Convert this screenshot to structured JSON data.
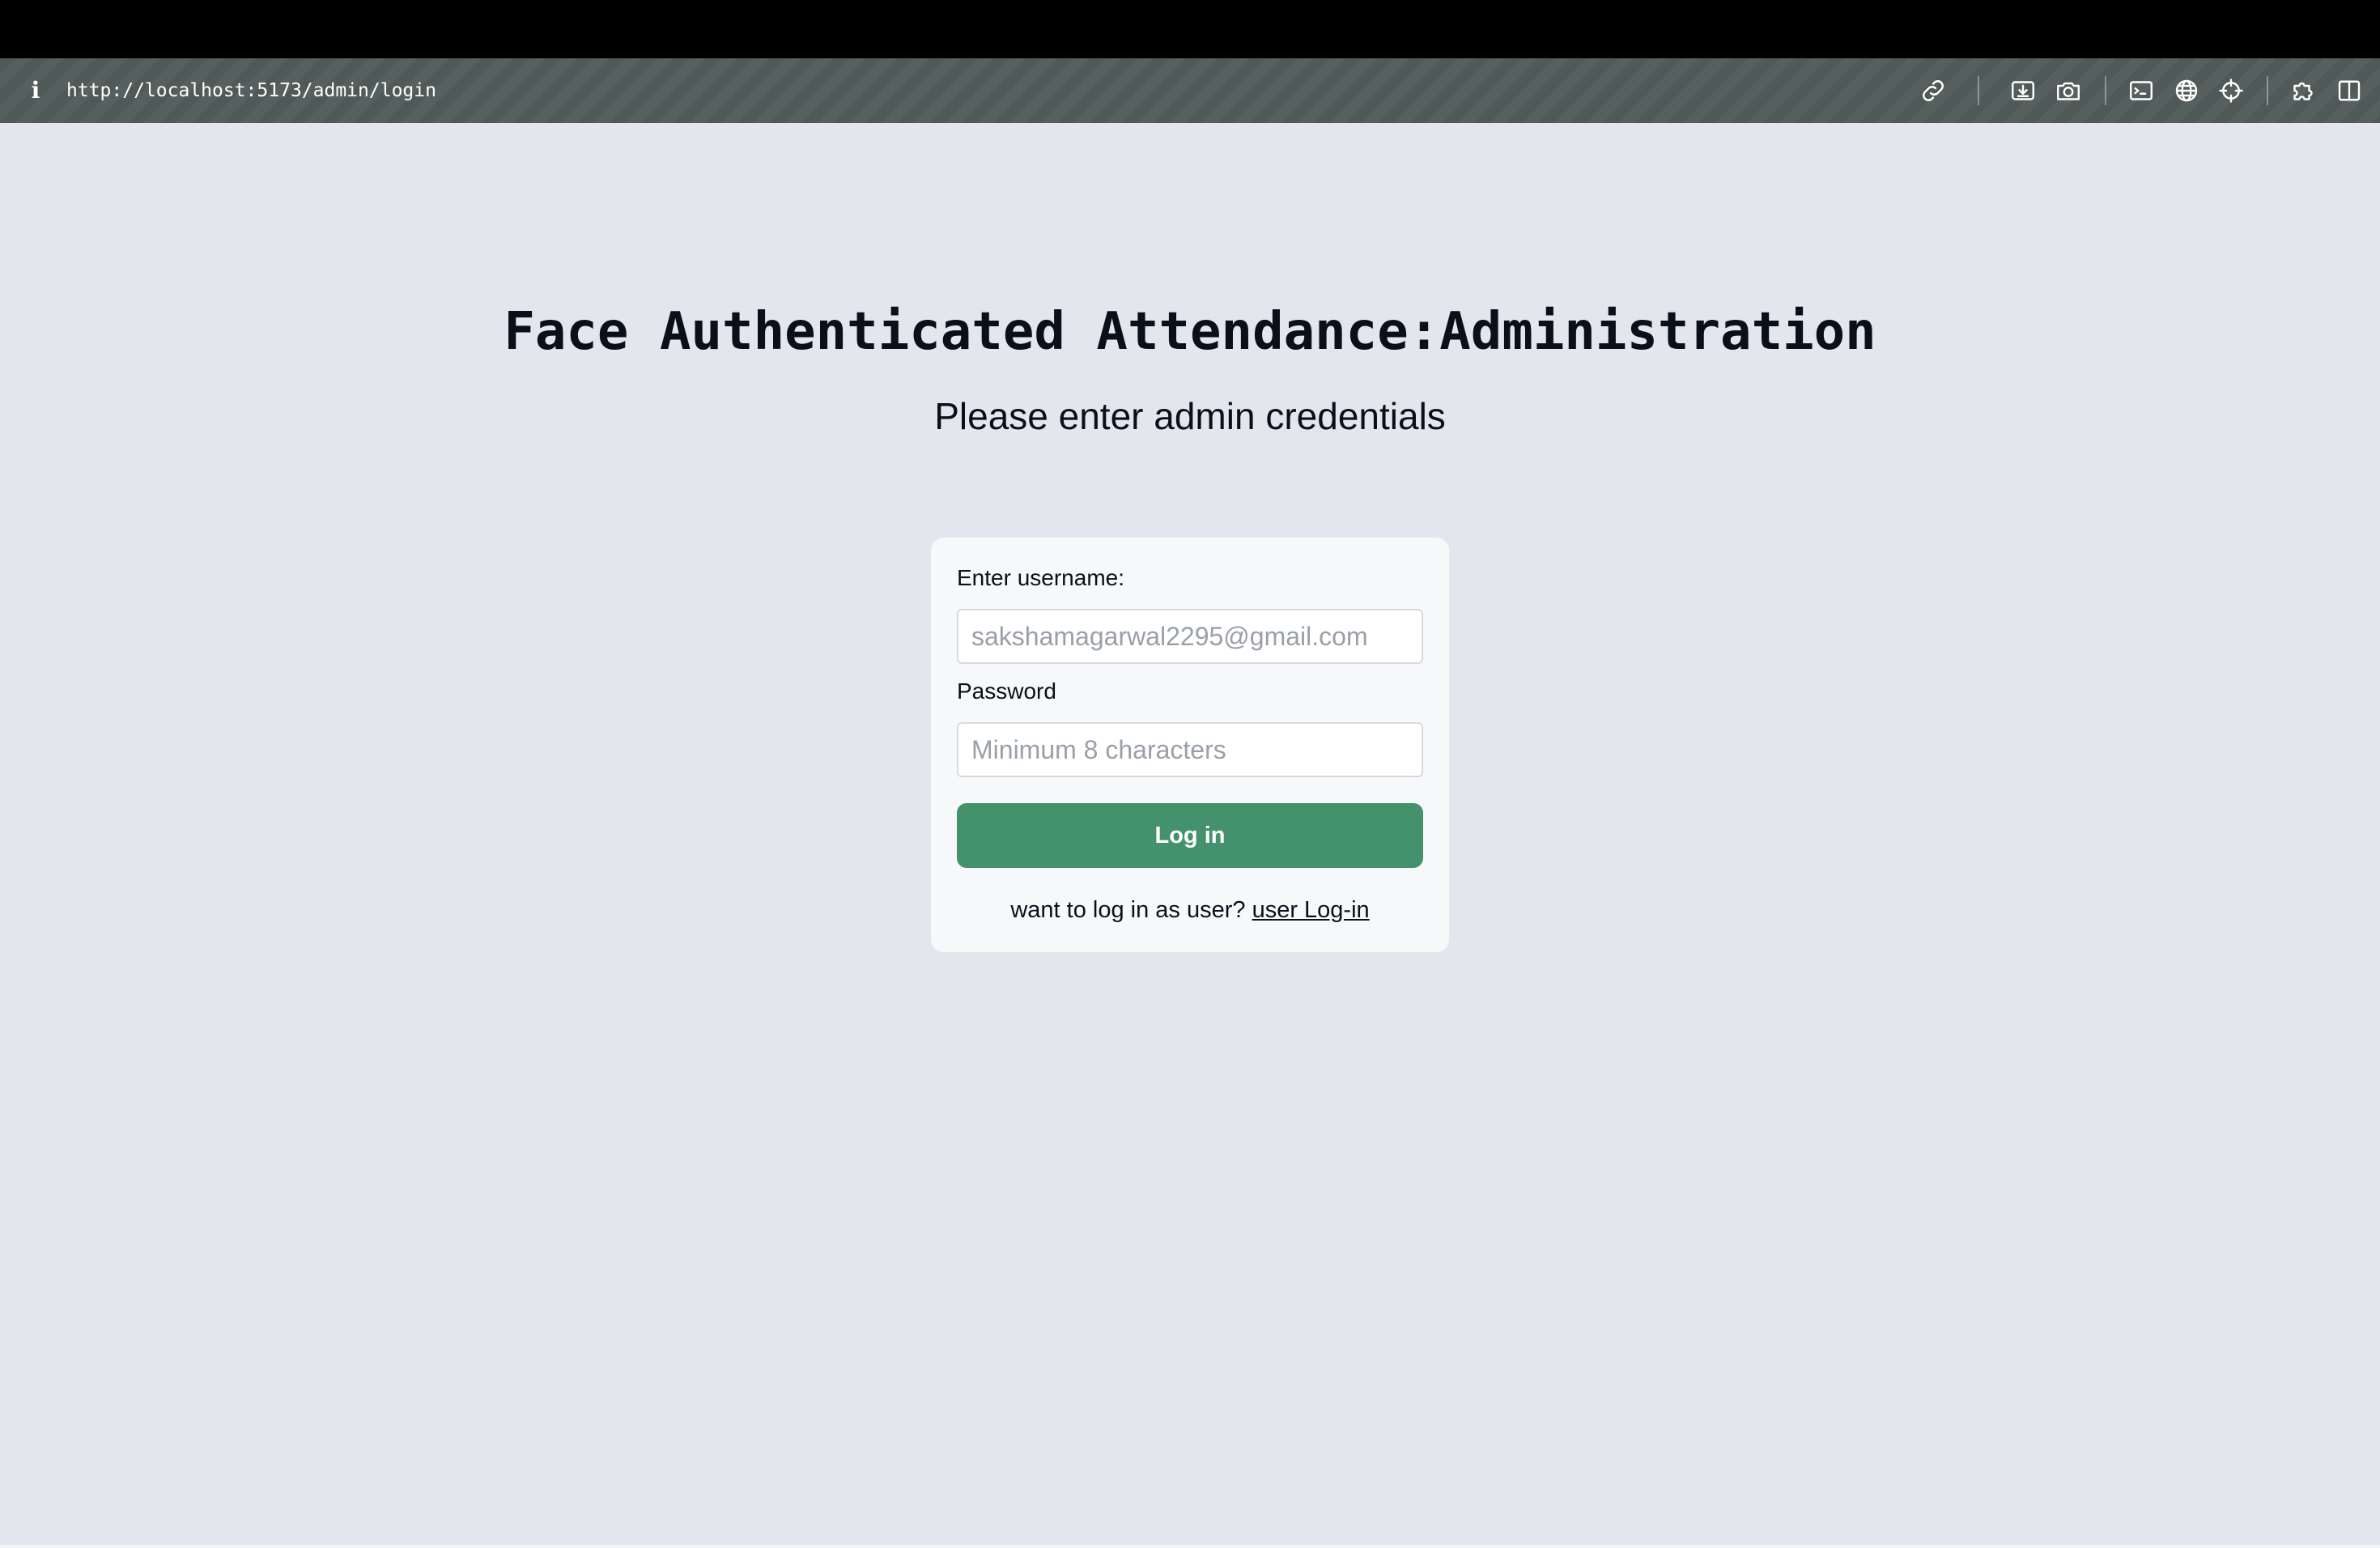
{
  "browser": {
    "url": "http://localhost:5173/admin/login",
    "info_icon": "info-icon",
    "toolbar_icons": [
      "link-icon",
      "download-icon",
      "camera-icon",
      "terminal-icon",
      "globe-icon",
      "crosshair-icon",
      "extension-icon",
      "split-view-icon"
    ]
  },
  "page": {
    "title": "Face Authenticated Attendance:Administration",
    "subtitle": "Please enter admin credentials"
  },
  "login_form": {
    "username_label": "Enter username:",
    "username_placeholder": "sakshamagarwal2295@gmail.com",
    "username_value": "",
    "password_label": "Password",
    "password_placeholder": "Minimum 8 characters",
    "password_value": "",
    "submit_label": "Log in",
    "footer_prompt": "want to log in as user?",
    "footer_link": "user Log-in",
    "button_color": "#44926c"
  },
  "colors": {
    "background": "#e3e7ed",
    "card": "#f7f8fa",
    "text": "#0b0f19"
  }
}
